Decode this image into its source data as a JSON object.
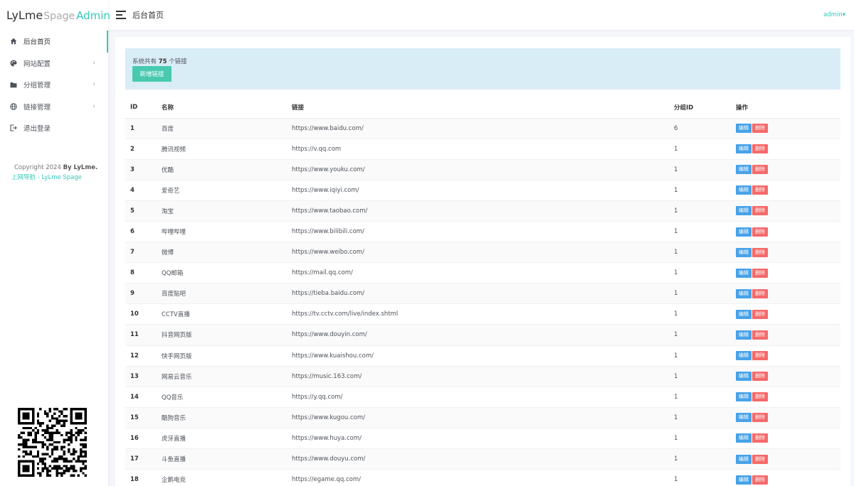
{
  "brand": {
    "part1": "LyLme",
    "part2": "Spage",
    "part3": "Admin"
  },
  "header": {
    "title": "后台首页",
    "user": "admin"
  },
  "sidebar": {
    "items": [
      {
        "label": "后台首页",
        "icon": "home-icon",
        "active": true
      },
      {
        "label": "网站配置",
        "icon": "palette-icon"
      },
      {
        "label": "分组管理",
        "icon": "folder-icon"
      },
      {
        "label": "链接管理",
        "icon": "globe-icon"
      },
      {
        "label": "退出登录",
        "icon": "logout-icon"
      }
    ],
    "copyright_prefix": "Copyright 2024",
    "copyright_by": "By LyLme.",
    "site_link": "上网导航 - LyLme Spage"
  },
  "alert": {
    "prefix": "系统共有",
    "count": "75",
    "suffix": "个链接",
    "add_button": "新增链接"
  },
  "table": {
    "headers": {
      "id": "ID",
      "name": "名称",
      "url": "链接",
      "group": "分组ID",
      "ops": "操作"
    },
    "edit_label": "编辑",
    "delete_label": "删除",
    "rows": [
      {
        "id": "1",
        "name": "百度",
        "url": "https://www.baidu.com/",
        "group": "6"
      },
      {
        "id": "2",
        "name": "腾讯视频",
        "url": "https://v.qq.com",
        "group": "1"
      },
      {
        "id": "3",
        "name": "优酷",
        "url": "https://www.youku.com/",
        "group": "1"
      },
      {
        "id": "4",
        "name": "爱奇艺",
        "url": "https://www.iqiyi.com/",
        "group": "1"
      },
      {
        "id": "5",
        "name": "淘宝",
        "url": "https://www.taobao.com/",
        "group": "1"
      },
      {
        "id": "6",
        "name": "哔哩哔哩",
        "url": "https://www.bilibili.com/",
        "group": "1"
      },
      {
        "id": "7",
        "name": "微博",
        "url": "https://www.weibo.com/",
        "group": "1"
      },
      {
        "id": "8",
        "name": "QQ邮箱",
        "url": "https://mail.qq.com/",
        "group": "1"
      },
      {
        "id": "9",
        "name": "百度贴吧",
        "url": "https://tieba.baidu.com/",
        "group": "1"
      },
      {
        "id": "10",
        "name": "CCTV直播",
        "url": "https://tv.cctv.com/live/index.shtml",
        "group": "1"
      },
      {
        "id": "11",
        "name": "抖音网页版",
        "url": "https://www.douyin.com/",
        "group": "1"
      },
      {
        "id": "12",
        "name": "快手网页版",
        "url": "https://www.kuaishou.com/",
        "group": "1"
      },
      {
        "id": "13",
        "name": "网易云音乐",
        "url": "https://music.163.com/",
        "group": "1"
      },
      {
        "id": "14",
        "name": "QQ音乐",
        "url": "https://y.qq.com/",
        "group": "1"
      },
      {
        "id": "15",
        "name": "酷狗音乐",
        "url": "https://www.kugou.com/",
        "group": "1"
      },
      {
        "id": "16",
        "name": "虎牙直播",
        "url": "https://www.huya.com/",
        "group": "1"
      },
      {
        "id": "17",
        "name": "斗鱼直播",
        "url": "https://www.douyu.com/",
        "group": "1"
      },
      {
        "id": "18",
        "name": "企鹅电竞",
        "url": "https://egame.qq.com/",
        "group": "1"
      }
    ]
  },
  "colors": {
    "accent": "#33cabb",
    "edit": "#48a2e8",
    "delete": "#f46a6a",
    "alert_bg": "#d9edf7"
  }
}
